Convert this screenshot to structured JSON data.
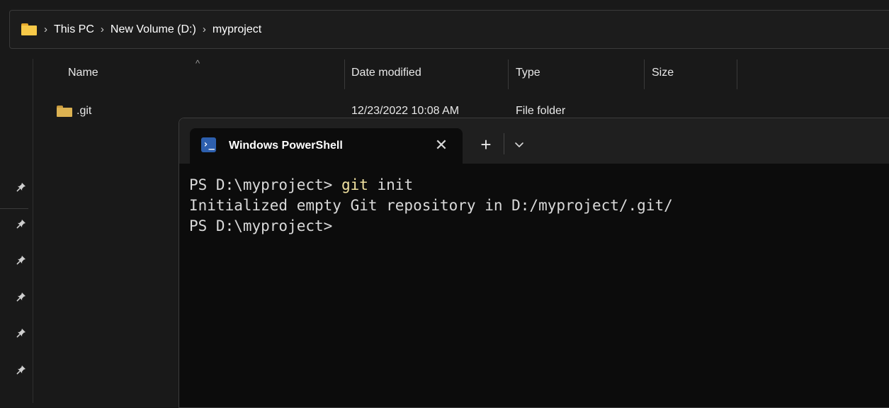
{
  "explorer": {
    "breadcrumb": [
      "This PC",
      "New Volume (D:)",
      "myproject"
    ],
    "columns": {
      "name": "Name",
      "date_modified": "Date modified",
      "type": "Type",
      "size": "Size"
    },
    "files": [
      {
        "name": ".git",
        "date_modified": "12/23/2022 10:08 AM",
        "type": "File folder"
      }
    ],
    "pinned_count": 6
  },
  "terminal": {
    "tab_title": "Windows PowerShell",
    "tab_icon": "powershell-icon",
    "close_glyph": "✕",
    "new_tab_glyph": "+",
    "lines": [
      {
        "prompt": "PS D:\\myproject> ",
        "command": "git",
        "args": " init"
      },
      {
        "output": "Initialized empty Git repository in D:/myproject/.git/"
      },
      {
        "prompt": "PS D:\\myproject>"
      }
    ]
  },
  "colors": {
    "background": "#191919",
    "terminal_bg": "#0c0c0c",
    "command_highlight": "#f2e2a0",
    "folder": "#f7c948"
  }
}
